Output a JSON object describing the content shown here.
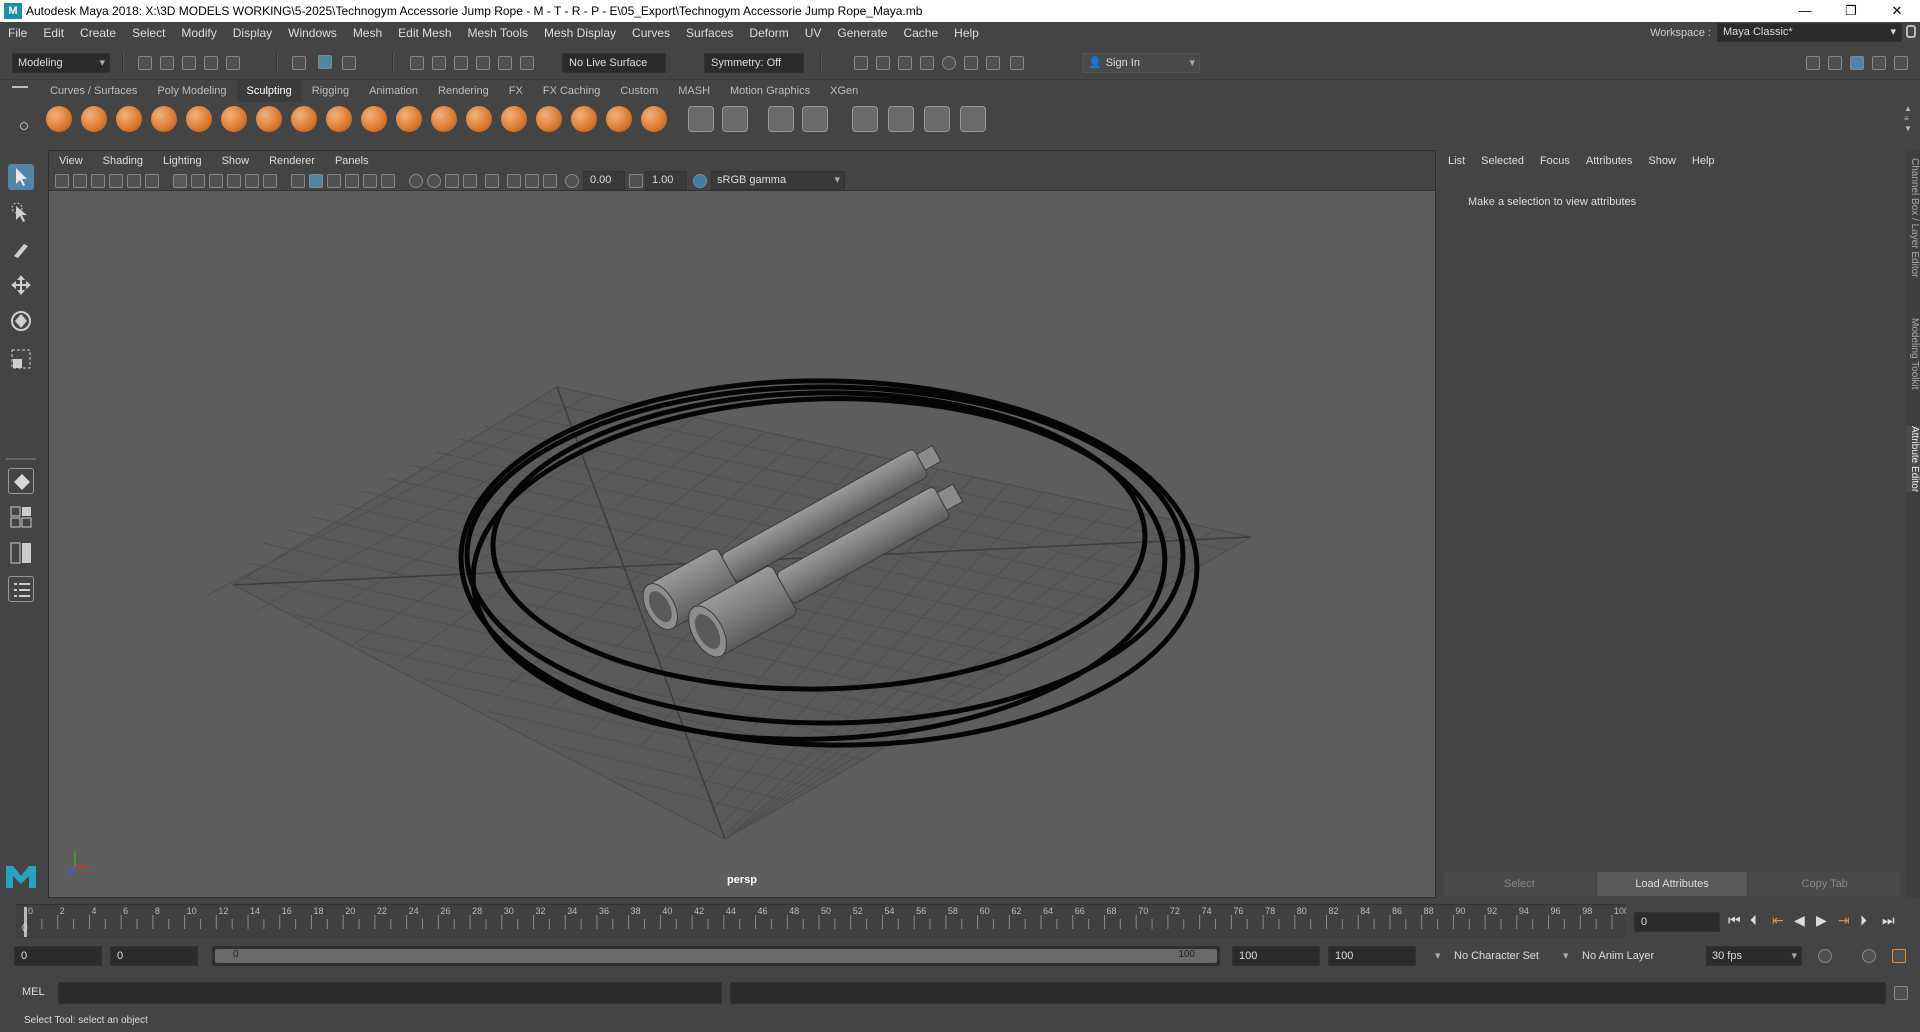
{
  "window": {
    "title": "Autodesk Maya 2018: X:\\3D MODELS WORKING\\5-2025\\Technogym Accessorie Jump Rope - M - T - R - P - E\\05_Export\\Technogym Accessorie Jump Rope_Maya.mb",
    "logo": "M",
    "controls": [
      "—",
      "❐",
      "✕"
    ]
  },
  "menubar": {
    "items": [
      "File",
      "Edit",
      "Create",
      "Select",
      "Modify",
      "Display",
      "Windows",
      "Mesh",
      "Edit Mesh",
      "Mesh Tools",
      "Mesh Display",
      "Curves",
      "Surfaces",
      "Deform",
      "UV",
      "Generate",
      "Cache",
      "Help"
    ],
    "workspace_label": "Workspace :",
    "workspace_value": "Maya Classic*"
  },
  "statusline": {
    "menuset": "Modeling",
    "live_surface": "No Live Surface",
    "symmetry": "Symmetry: Off",
    "sign_in": "Sign In"
  },
  "shelf": {
    "tabs": [
      "Curves / Surfaces",
      "Poly Modeling",
      "Sculpting",
      "Rigging",
      "Animation",
      "Rendering",
      "FX",
      "FX Caching",
      "Custom",
      "MASH",
      "Motion Graphics",
      "XGen"
    ],
    "active_tab": "Sculpting"
  },
  "viewport": {
    "menu": [
      "View",
      "Shading",
      "Lighting",
      "Show",
      "Renderer",
      "Panels"
    ],
    "exposure": "0.00",
    "gamma": "1.00",
    "color_space": "sRGB gamma",
    "camera_label": "persp"
  },
  "attribute_editor": {
    "menu": [
      "List",
      "Selected",
      "Focus",
      "Attributes",
      "Show",
      "Help"
    ],
    "message": "Make a selection to view attributes",
    "buttons": [
      "Select",
      "Load Attributes",
      "Copy Tab"
    ],
    "side_tabs": [
      "Channel Box / Layer Editor",
      "Modeling Toolkit",
      "Attribute Editor"
    ]
  },
  "timeslider": {
    "ticks": [
      "0",
      "2",
      "4",
      "6",
      "8",
      "10",
      "12",
      "14",
      "16",
      "18",
      "20",
      "22",
      "24",
      "26",
      "28",
      "30",
      "32",
      "34",
      "36",
      "38",
      "40",
      "42",
      "44",
      "46",
      "48",
      "50",
      "52",
      "54",
      "56",
      "58",
      "60",
      "62",
      "64",
      "66",
      "68",
      "70",
      "72",
      "74",
      "76",
      "78",
      "80",
      "82",
      "84",
      "86",
      "88",
      "90",
      "92",
      "94",
      "96",
      "98",
      "100"
    ],
    "current_frame": "0",
    "current_marker": "0"
  },
  "range": {
    "start": "0",
    "anim_start": "0",
    "range_start_label": "0",
    "range_end_label": "100",
    "anim_end": "100",
    "end": "100",
    "character_set": "No Character Set",
    "anim_layer": "No Anim Layer",
    "fps": "30 fps"
  },
  "commandline": {
    "label": "MEL"
  },
  "helpline": {
    "text": "Select Tool: select an object"
  }
}
